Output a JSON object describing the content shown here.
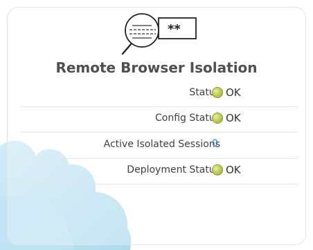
{
  "panel": {
    "title": "Remote Browser Isolation",
    "logo_mask_text": "**",
    "rows": [
      {
        "label": "Status",
        "value": "OK",
        "indicator": "ok-status-icon"
      },
      {
        "label": "Config Status",
        "value": "OK",
        "indicator": "ok-status-icon"
      },
      {
        "label": "Active Isolated Sessions",
        "value": "0"
      },
      {
        "label": "Deployment Status",
        "value": "OK",
        "indicator": "ok-status-icon"
      }
    ]
  },
  "colors": {
    "title": "#4f4f4f",
    "ok_indicator": "#c4cf5a",
    "link_value": "#2f7fc4",
    "cloud": "#b9e1f3"
  }
}
